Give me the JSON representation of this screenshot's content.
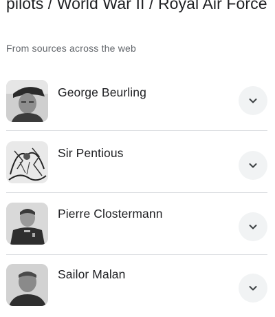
{
  "header": {
    "title": "pilots / World War II / Royal Air Force",
    "subtitle": "From sources across the web"
  },
  "items": [
    {
      "name": "George Beurling",
      "image_icon": "portrait-photo",
      "expand_icon": "chevron-down-icon"
    },
    {
      "name": "Sir Pentious",
      "image_icon": "cartoon-illustration",
      "expand_icon": "chevron-down-icon"
    },
    {
      "name": "Pierre Clostermann",
      "image_icon": "portrait-photo",
      "expand_icon": "chevron-down-icon"
    },
    {
      "name": "Sailor Malan",
      "image_icon": "portrait-photo",
      "expand_icon": "chevron-down-icon"
    }
  ],
  "colors": {
    "text": "#202124",
    "secondary_text": "#5f6368",
    "divider": "#dadce0",
    "chevron_bg": "#f1f3f4",
    "chevron": "#3c4043"
  }
}
